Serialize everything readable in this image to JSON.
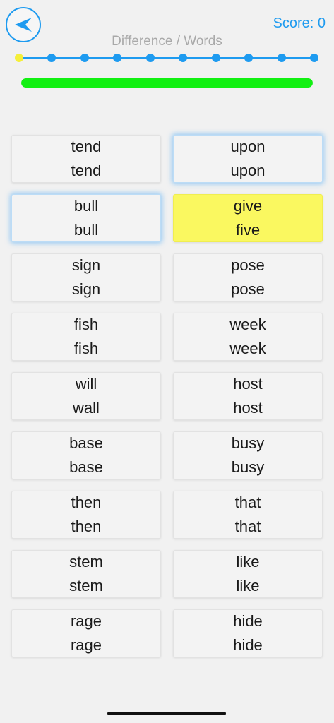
{
  "header": {
    "score_label": "Score:",
    "score_value": "0",
    "title": "Difference / Words"
  },
  "steps": {
    "count": 10,
    "current_index": 0
  },
  "progress": {
    "value_percent": 100,
    "color": "#12f012"
  },
  "colors": {
    "accent": "#1e9bf0",
    "highlight": "#faf860",
    "current_step": "#f5ef3a"
  },
  "pairs": [
    {
      "top": "tend",
      "bottom": "tend",
      "state": "normal"
    },
    {
      "top": "upon",
      "bottom": "upon",
      "state": "glow"
    },
    {
      "top": "bull",
      "bottom": "bull",
      "state": "glow"
    },
    {
      "top": "give",
      "bottom": "five",
      "state": "highlighted"
    },
    {
      "top": "sign",
      "bottom": "sign",
      "state": "normal"
    },
    {
      "top": "pose",
      "bottom": "pose",
      "state": "normal"
    },
    {
      "top": "fish",
      "bottom": "fish",
      "state": "normal"
    },
    {
      "top": "week",
      "bottom": "week",
      "state": "normal"
    },
    {
      "top": "will",
      "bottom": "wall",
      "state": "normal"
    },
    {
      "top": "host",
      "bottom": "host",
      "state": "normal"
    },
    {
      "top": "base",
      "bottom": "base",
      "state": "normal"
    },
    {
      "top": "busy",
      "bottom": "busy",
      "state": "normal"
    },
    {
      "top": "then",
      "bottom": "then",
      "state": "normal"
    },
    {
      "top": "that",
      "bottom": "that",
      "state": "normal"
    },
    {
      "top": "stem",
      "bottom": "stem",
      "state": "normal"
    },
    {
      "top": "like",
      "bottom": "like",
      "state": "normal"
    },
    {
      "top": "rage",
      "bottom": "rage",
      "state": "normal"
    },
    {
      "top": "hide",
      "bottom": "hide",
      "state": "normal"
    }
  ]
}
